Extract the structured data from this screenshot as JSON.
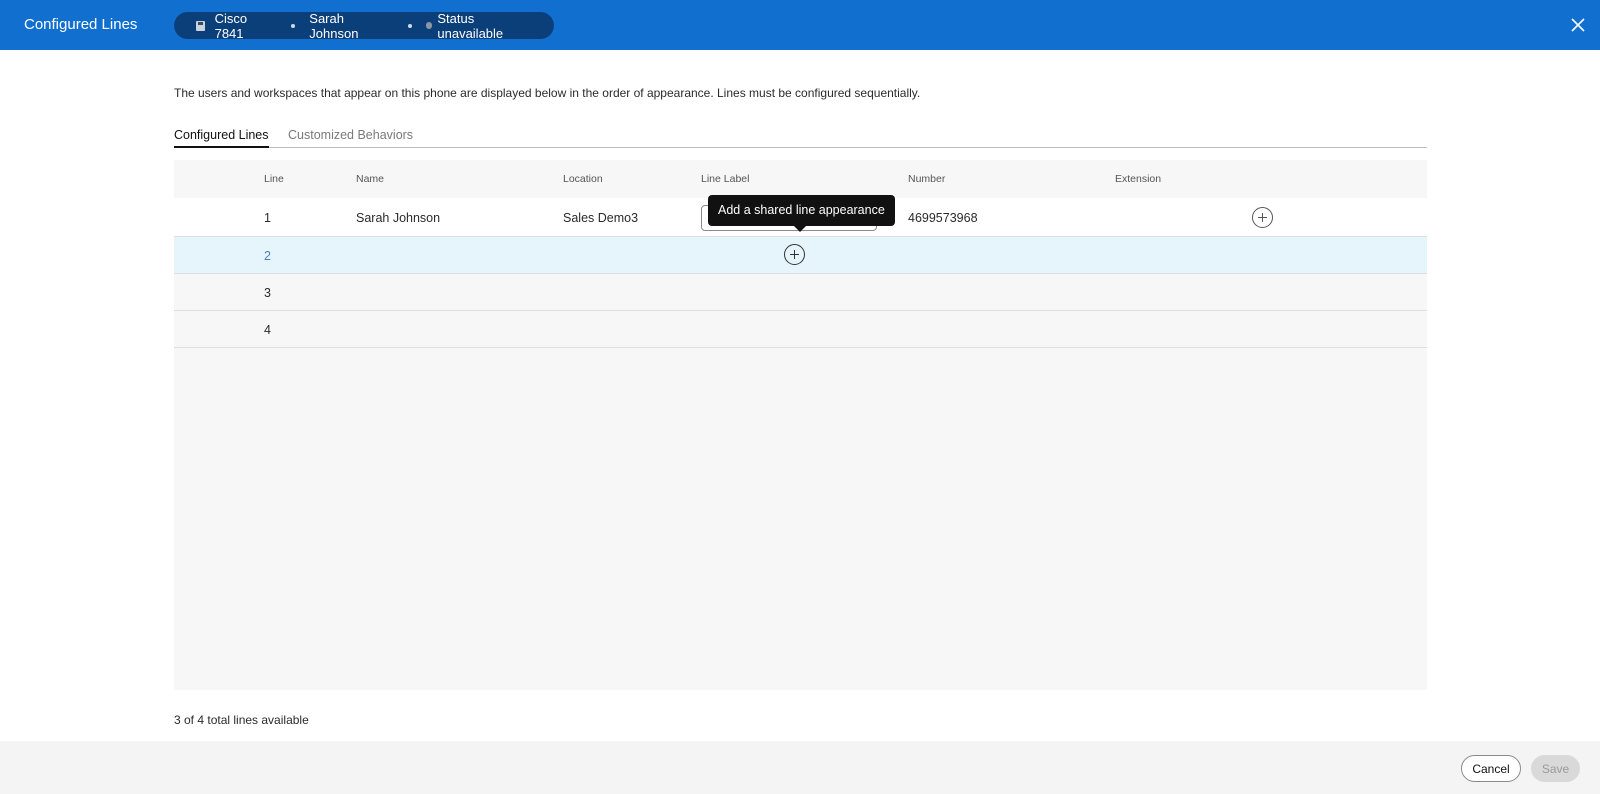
{
  "header": {
    "title": "Configured Lines",
    "device": {
      "model": "Cisco 7841",
      "user": "Sarah Johnson",
      "status": "Status unavailable"
    }
  },
  "intro_text": "The users and workspaces that appear on this phone are displayed below in the order of appearance. Lines must be configured sequentially.",
  "tabs": [
    {
      "label": "Configured Lines",
      "active": true
    },
    {
      "label": "Customized Behaviors",
      "active": false
    }
  ],
  "table": {
    "columns": [
      "Line",
      "Name",
      "Location",
      "Line Label",
      "Number",
      "Extension"
    ],
    "rows": [
      {
        "line": "1",
        "name": "Sarah Johnson",
        "location": "Sales Demo3",
        "line_label": "",
        "number": "4699573968",
        "extension": ""
      },
      {
        "line": "2",
        "name": "",
        "location": "",
        "line_label": "",
        "number": "",
        "extension": ""
      },
      {
        "line": "3",
        "name": "",
        "location": "",
        "line_label": "",
        "number": "",
        "extension": ""
      },
      {
        "line": "4",
        "name": "",
        "location": "",
        "line_label": "",
        "number": "",
        "extension": ""
      }
    ]
  },
  "tooltip": "Add a shared line appearance",
  "lines_available": "3 of 4 total lines available",
  "footer": {
    "cancel_label": "Cancel",
    "save_label": "Save"
  },
  "icons": {
    "close": "close-icon",
    "add": "add-circle-icon",
    "phone": "phone-device-icon"
  },
  "colors": {
    "header_bg": "#1170cf",
    "pill_bg": "#0b3f7a",
    "selected_row": "#e6f4fc",
    "tooltip_bg": "#111111"
  }
}
